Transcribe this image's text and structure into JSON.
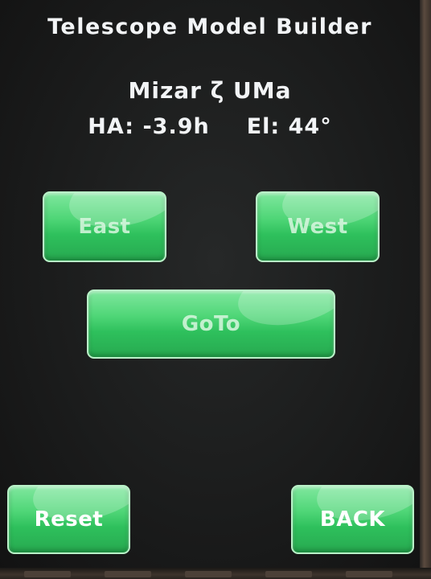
{
  "app": {
    "title": "Telescope Model Builder"
  },
  "target": {
    "name": "Mizar ζ UMa",
    "ha_label": "HA:",
    "ha_value": "-3.9h",
    "el_label": "El:",
    "el_value": "44°"
  },
  "buttons": {
    "east": "East",
    "west": "West",
    "goto": "GoTo",
    "reset": "Reset",
    "back": "BACK"
  },
  "colors": {
    "button_green": "#4fd677",
    "button_border": "#b9f2c8",
    "text": "#f2f4f6",
    "background": "#1b1c1c"
  }
}
